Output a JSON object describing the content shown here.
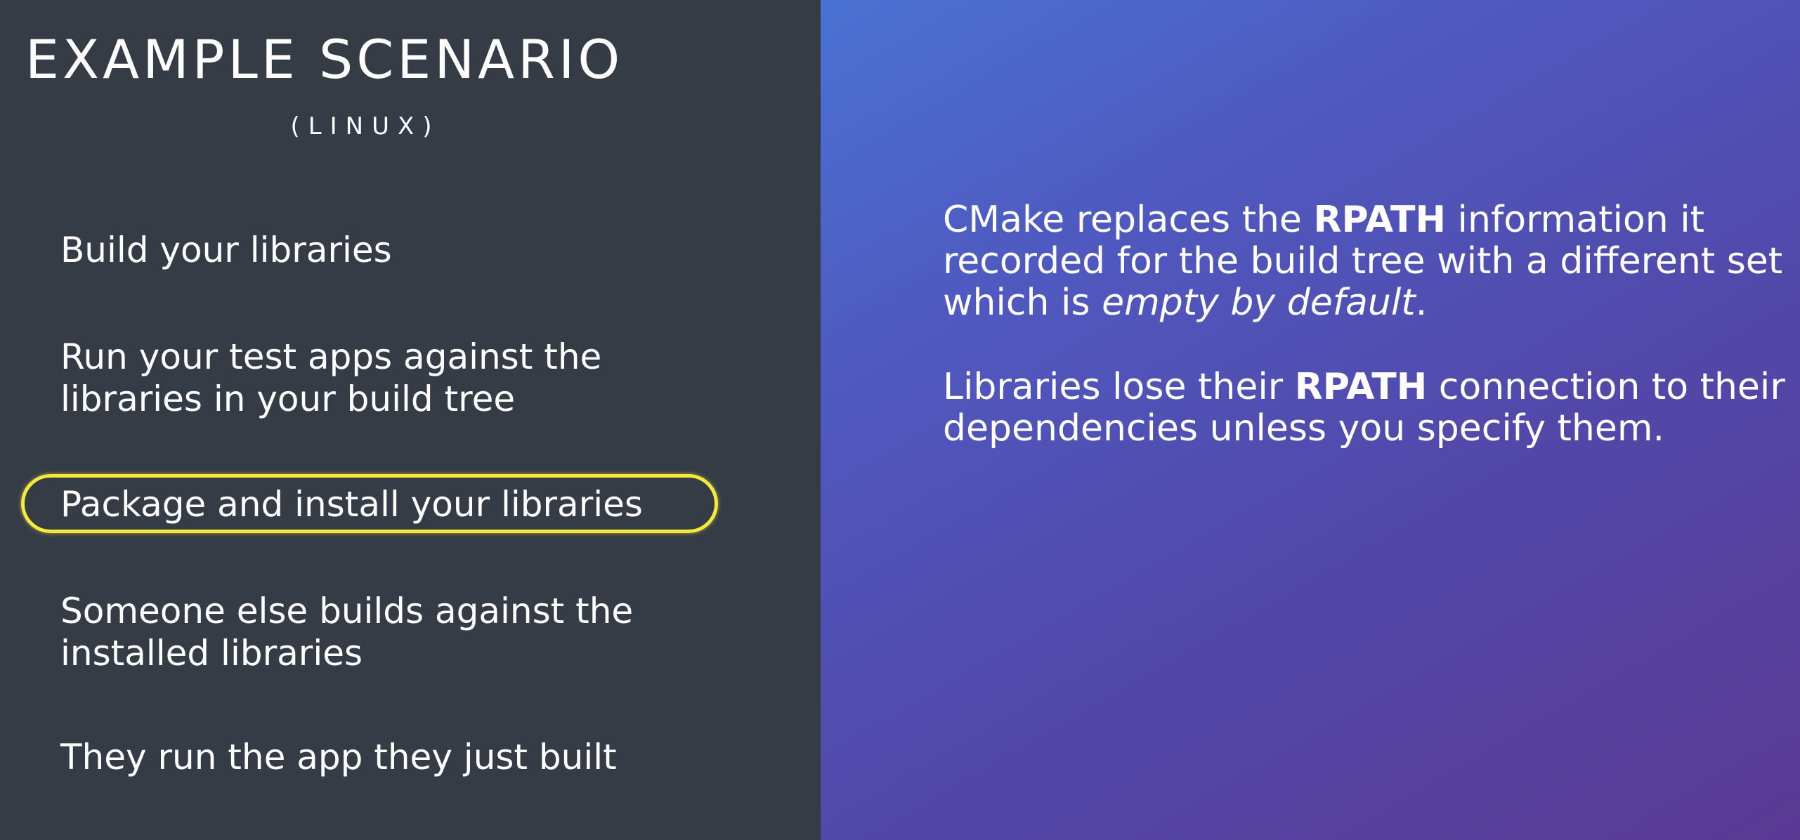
{
  "slide": {
    "title": "EXAMPLE SCENARIO",
    "subtitle": "(LINUX)",
    "highlight_color": "#f3ea3c",
    "steps": [
      {
        "label": "Build your libraries",
        "highlighted": false
      },
      {
        "label": "Run your test apps against the\nlibraries in your build tree",
        "highlighted": false
      },
      {
        "label": "Package and install your libraries",
        "highlighted": true
      },
      {
        "label": "Someone else builds against the\ninstalled libraries",
        "highlighted": false
      },
      {
        "label": "They run the app they just built",
        "highlighted": false
      }
    ],
    "paragraph1": {
      "before": "CMake replaces the ",
      "bold": "RPATH",
      "middle": " information it recorded for the build tree with a different set which is ",
      "italic": "empty by default",
      "after": "."
    },
    "paragraph2": {
      "before": "Libraries lose their ",
      "bold": "RPATH",
      "after": " connection to their dependencies unless you specify them."
    }
  }
}
